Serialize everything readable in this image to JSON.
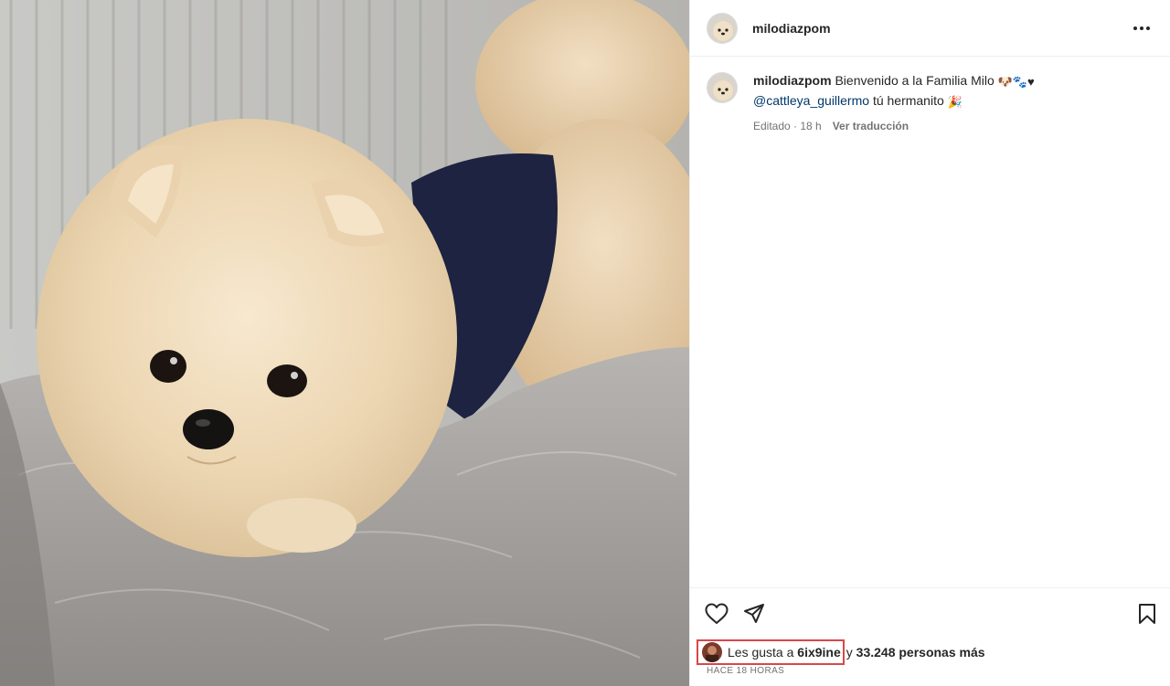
{
  "post": {
    "username": "milodiazpom",
    "image_description": "Fluffy cream Pomeranian puppy on a grey plush bed",
    "caption": {
      "username": "milodiazpom",
      "text_line1": "Bienvenido a la Familia Milo",
      "emoji_line1": "🐶🐾♥",
      "mention": "@cattleya_guillermo",
      "text_line2": "tú hermanito",
      "emoji_line2": "🎉"
    },
    "meta": {
      "edited": "Editado · 18 h",
      "translate": "Ver traducción"
    },
    "likes": {
      "prefix": "Les gusta a",
      "user": "6ix9ine",
      "and": "y",
      "others": "33.248 personas más"
    },
    "timestamp": "HACE 18 HORAS"
  },
  "icons": {
    "more": "more-options-icon",
    "like": "heart-icon",
    "share": "send-icon",
    "save": "bookmark-icon"
  },
  "colors": {
    "text": "#262626",
    "secondary": "#737373",
    "link": "#00376b",
    "highlight_box": "#d9474a",
    "border": "#efefef"
  }
}
